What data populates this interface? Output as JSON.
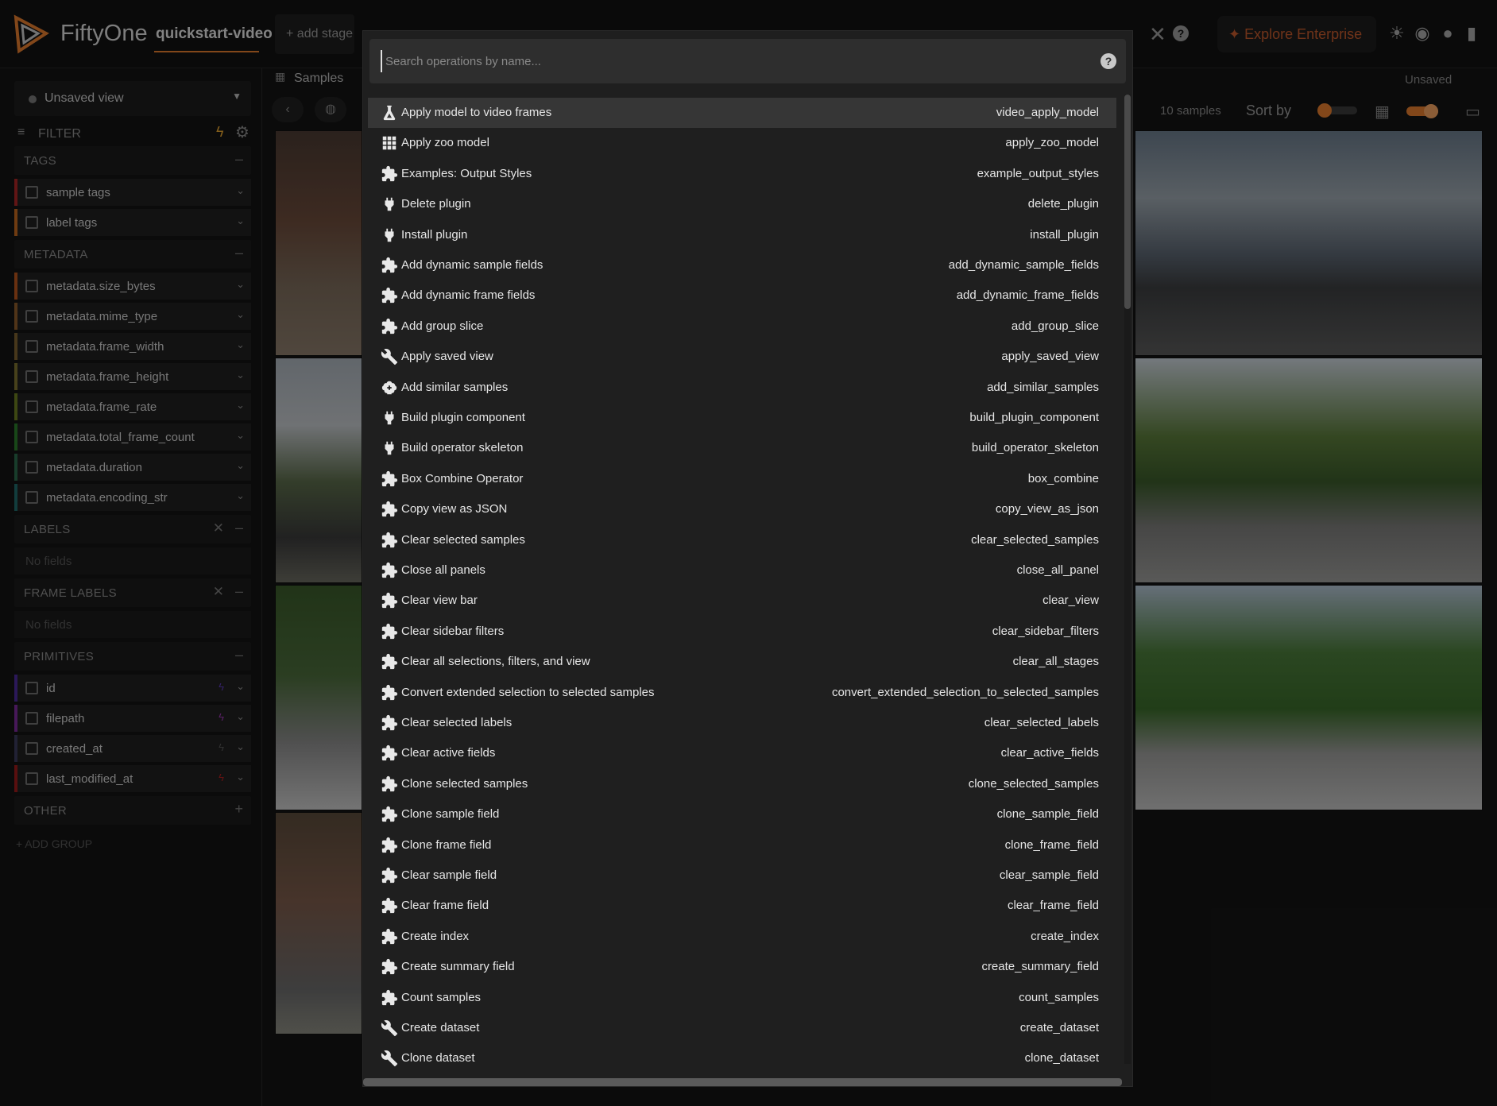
{
  "header": {
    "brand": "FiftyOne",
    "dataset": "quickstart-video",
    "add_stage": "+ add stage",
    "explore": "Explore Enterprise",
    "close_icon": "close-icon",
    "help_icon": "help-icon",
    "accent": "#e07a2e"
  },
  "sidebar": {
    "view_label": "Unsaved view",
    "filter_label": "FILTER",
    "sections": {
      "tags": "TAGS",
      "metadata": "METADATA",
      "labels": "LABELS",
      "frame_labels": "FRAME LABELS",
      "primitives": "PRIMITIVES",
      "other": "OTHER"
    },
    "tag_items": [
      "sample tags",
      "label tags"
    ],
    "metadata_items": [
      "metadata.size_bytes",
      "metadata.mime_type",
      "metadata.frame_width",
      "metadata.frame_height",
      "metadata.frame_rate",
      "metadata.total_frame_count",
      "metadata.duration",
      "metadata.encoding_str"
    ],
    "no_fields": "No fields",
    "primitive_items": [
      "id",
      "filepath",
      "created_at",
      "last_modified_at"
    ],
    "add_group": "+ ADD GROUP"
  },
  "main": {
    "tab": "Samples",
    "unsaved": "Unsaved",
    "sample_count": "10 samples",
    "sort_by": "Sort by"
  },
  "operator_browser": {
    "search_placeholder": "Search operations by name...",
    "operators": [
      {
        "label": "Apply model to video frames",
        "name": "video_apply_model",
        "icon": "flask-icon"
      },
      {
        "label": "Apply zoo model",
        "name": "apply_zoo_model",
        "icon": "grid-icon"
      },
      {
        "label": "Examples: Output Styles",
        "name": "example_output_styles",
        "icon": "puzzle-icon"
      },
      {
        "label": "Delete plugin",
        "name": "delete_plugin",
        "icon": "plug-icon"
      },
      {
        "label": "Install plugin",
        "name": "install_plugin",
        "icon": "plug-icon"
      },
      {
        "label": "Add dynamic sample fields",
        "name": "add_dynamic_sample_fields",
        "icon": "puzzle-icon"
      },
      {
        "label": "Add dynamic frame fields",
        "name": "add_dynamic_frame_fields",
        "icon": "puzzle-icon"
      },
      {
        "label": "Add group slice",
        "name": "add_group_slice",
        "icon": "puzzle-icon"
      },
      {
        "label": "Apply saved view",
        "name": "apply_saved_view",
        "icon": "wrench-icon"
      },
      {
        "label": "Add similar samples",
        "name": "add_similar_samples",
        "icon": "brain-icon"
      },
      {
        "label": "Build plugin component",
        "name": "build_plugin_component",
        "icon": "plug-icon"
      },
      {
        "label": "Build operator skeleton",
        "name": "build_operator_skeleton",
        "icon": "plug-icon"
      },
      {
        "label": "Box Combine Operator",
        "name": "box_combine",
        "icon": "puzzle-icon"
      },
      {
        "label": "Copy view as JSON",
        "name": "copy_view_as_json",
        "icon": "puzzle-icon"
      },
      {
        "label": "Clear selected samples",
        "name": "clear_selected_samples",
        "icon": "puzzle-icon"
      },
      {
        "label": "Close all panels",
        "name": "close_all_panel",
        "icon": "puzzle-icon"
      },
      {
        "label": "Clear view bar",
        "name": "clear_view",
        "icon": "puzzle-icon"
      },
      {
        "label": "Clear sidebar filters",
        "name": "clear_sidebar_filters",
        "icon": "puzzle-icon"
      },
      {
        "label": "Clear all selections, filters, and view",
        "name": "clear_all_stages",
        "icon": "puzzle-icon"
      },
      {
        "label": "Convert extended selection to selected samples",
        "name": "convert_extended_selection_to_selected_samples",
        "icon": "puzzle-icon"
      },
      {
        "label": "Clear selected labels",
        "name": "clear_selected_labels",
        "icon": "puzzle-icon"
      },
      {
        "label": "Clear active fields",
        "name": "clear_active_fields",
        "icon": "puzzle-icon"
      },
      {
        "label": "Clone selected samples",
        "name": "clone_selected_samples",
        "icon": "puzzle-icon"
      },
      {
        "label": "Clone sample field",
        "name": "clone_sample_field",
        "icon": "puzzle-icon"
      },
      {
        "label": "Clone frame field",
        "name": "clone_frame_field",
        "icon": "puzzle-icon"
      },
      {
        "label": "Clear sample field",
        "name": "clear_sample_field",
        "icon": "puzzle-icon"
      },
      {
        "label": "Clear frame field",
        "name": "clear_frame_field",
        "icon": "puzzle-icon"
      },
      {
        "label": "Create index",
        "name": "create_index",
        "icon": "puzzle-icon"
      },
      {
        "label": "Create summary field",
        "name": "create_summary_field",
        "icon": "puzzle-icon"
      },
      {
        "label": "Count samples",
        "name": "count_samples",
        "icon": "puzzle-icon"
      },
      {
        "label": "Create dataset",
        "name": "create_dataset",
        "icon": "wrench-icon"
      },
      {
        "label": "Clone dataset",
        "name": "clone_dataset",
        "icon": "wrench-icon"
      }
    ]
  }
}
